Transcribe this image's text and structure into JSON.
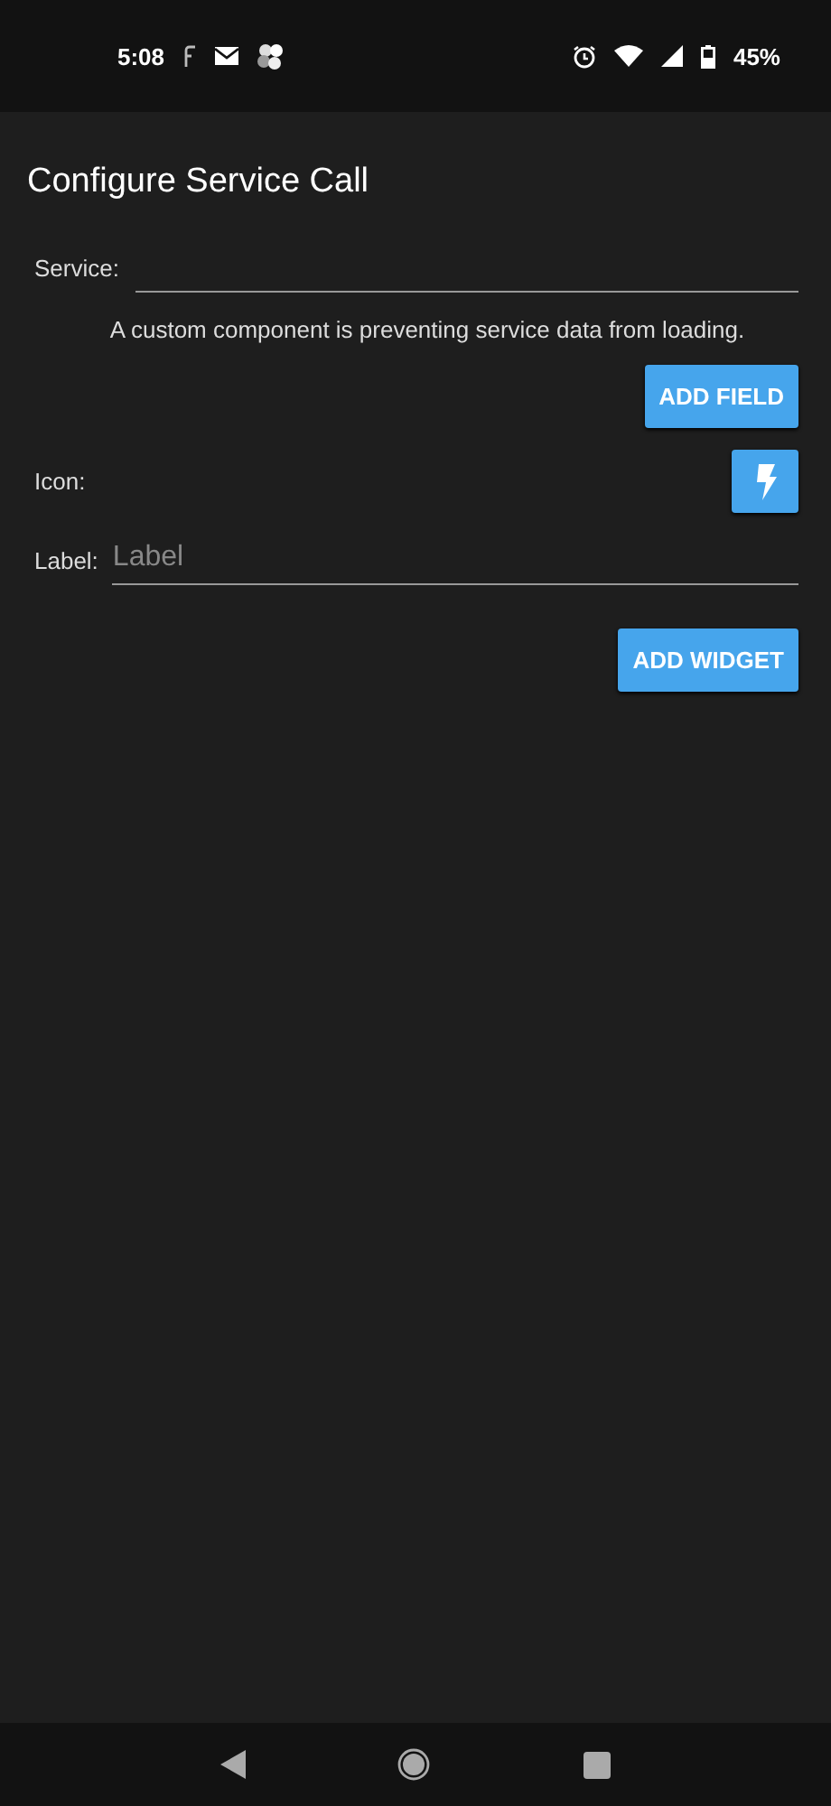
{
  "status_bar": {
    "time": "5:08",
    "battery": "45%"
  },
  "title": "Configure Service Call",
  "service_field": {
    "label": "Service:"
  },
  "message": "A custom component is preventing service data from loading.",
  "add_field_button": "ADD FIELD",
  "icon_row": {
    "label": "Icon:"
  },
  "label_field": {
    "label": "Label:",
    "placeholder": "Label"
  },
  "add_widget_button": "ADD WIDGET"
}
